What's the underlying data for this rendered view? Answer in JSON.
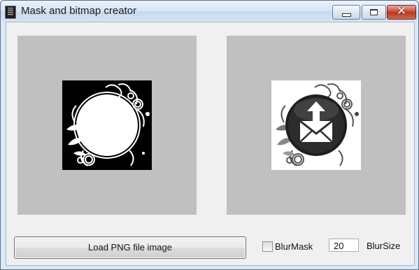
{
  "window": {
    "title": "Mask and bitmap creator"
  },
  "caption_buttons": {
    "minimize": "minimize",
    "maximize": "maximize",
    "close": "✕"
  },
  "controls": {
    "load_button": "Load PNG file image",
    "blur_mask_label": "BlurMask",
    "blur_mask_checked": false,
    "blur_size_value": "20",
    "blur_size_label": "BlurSize"
  },
  "icons": {
    "left_image": "mask-preview-icon",
    "right_image": "email-upload-icon"
  }
}
